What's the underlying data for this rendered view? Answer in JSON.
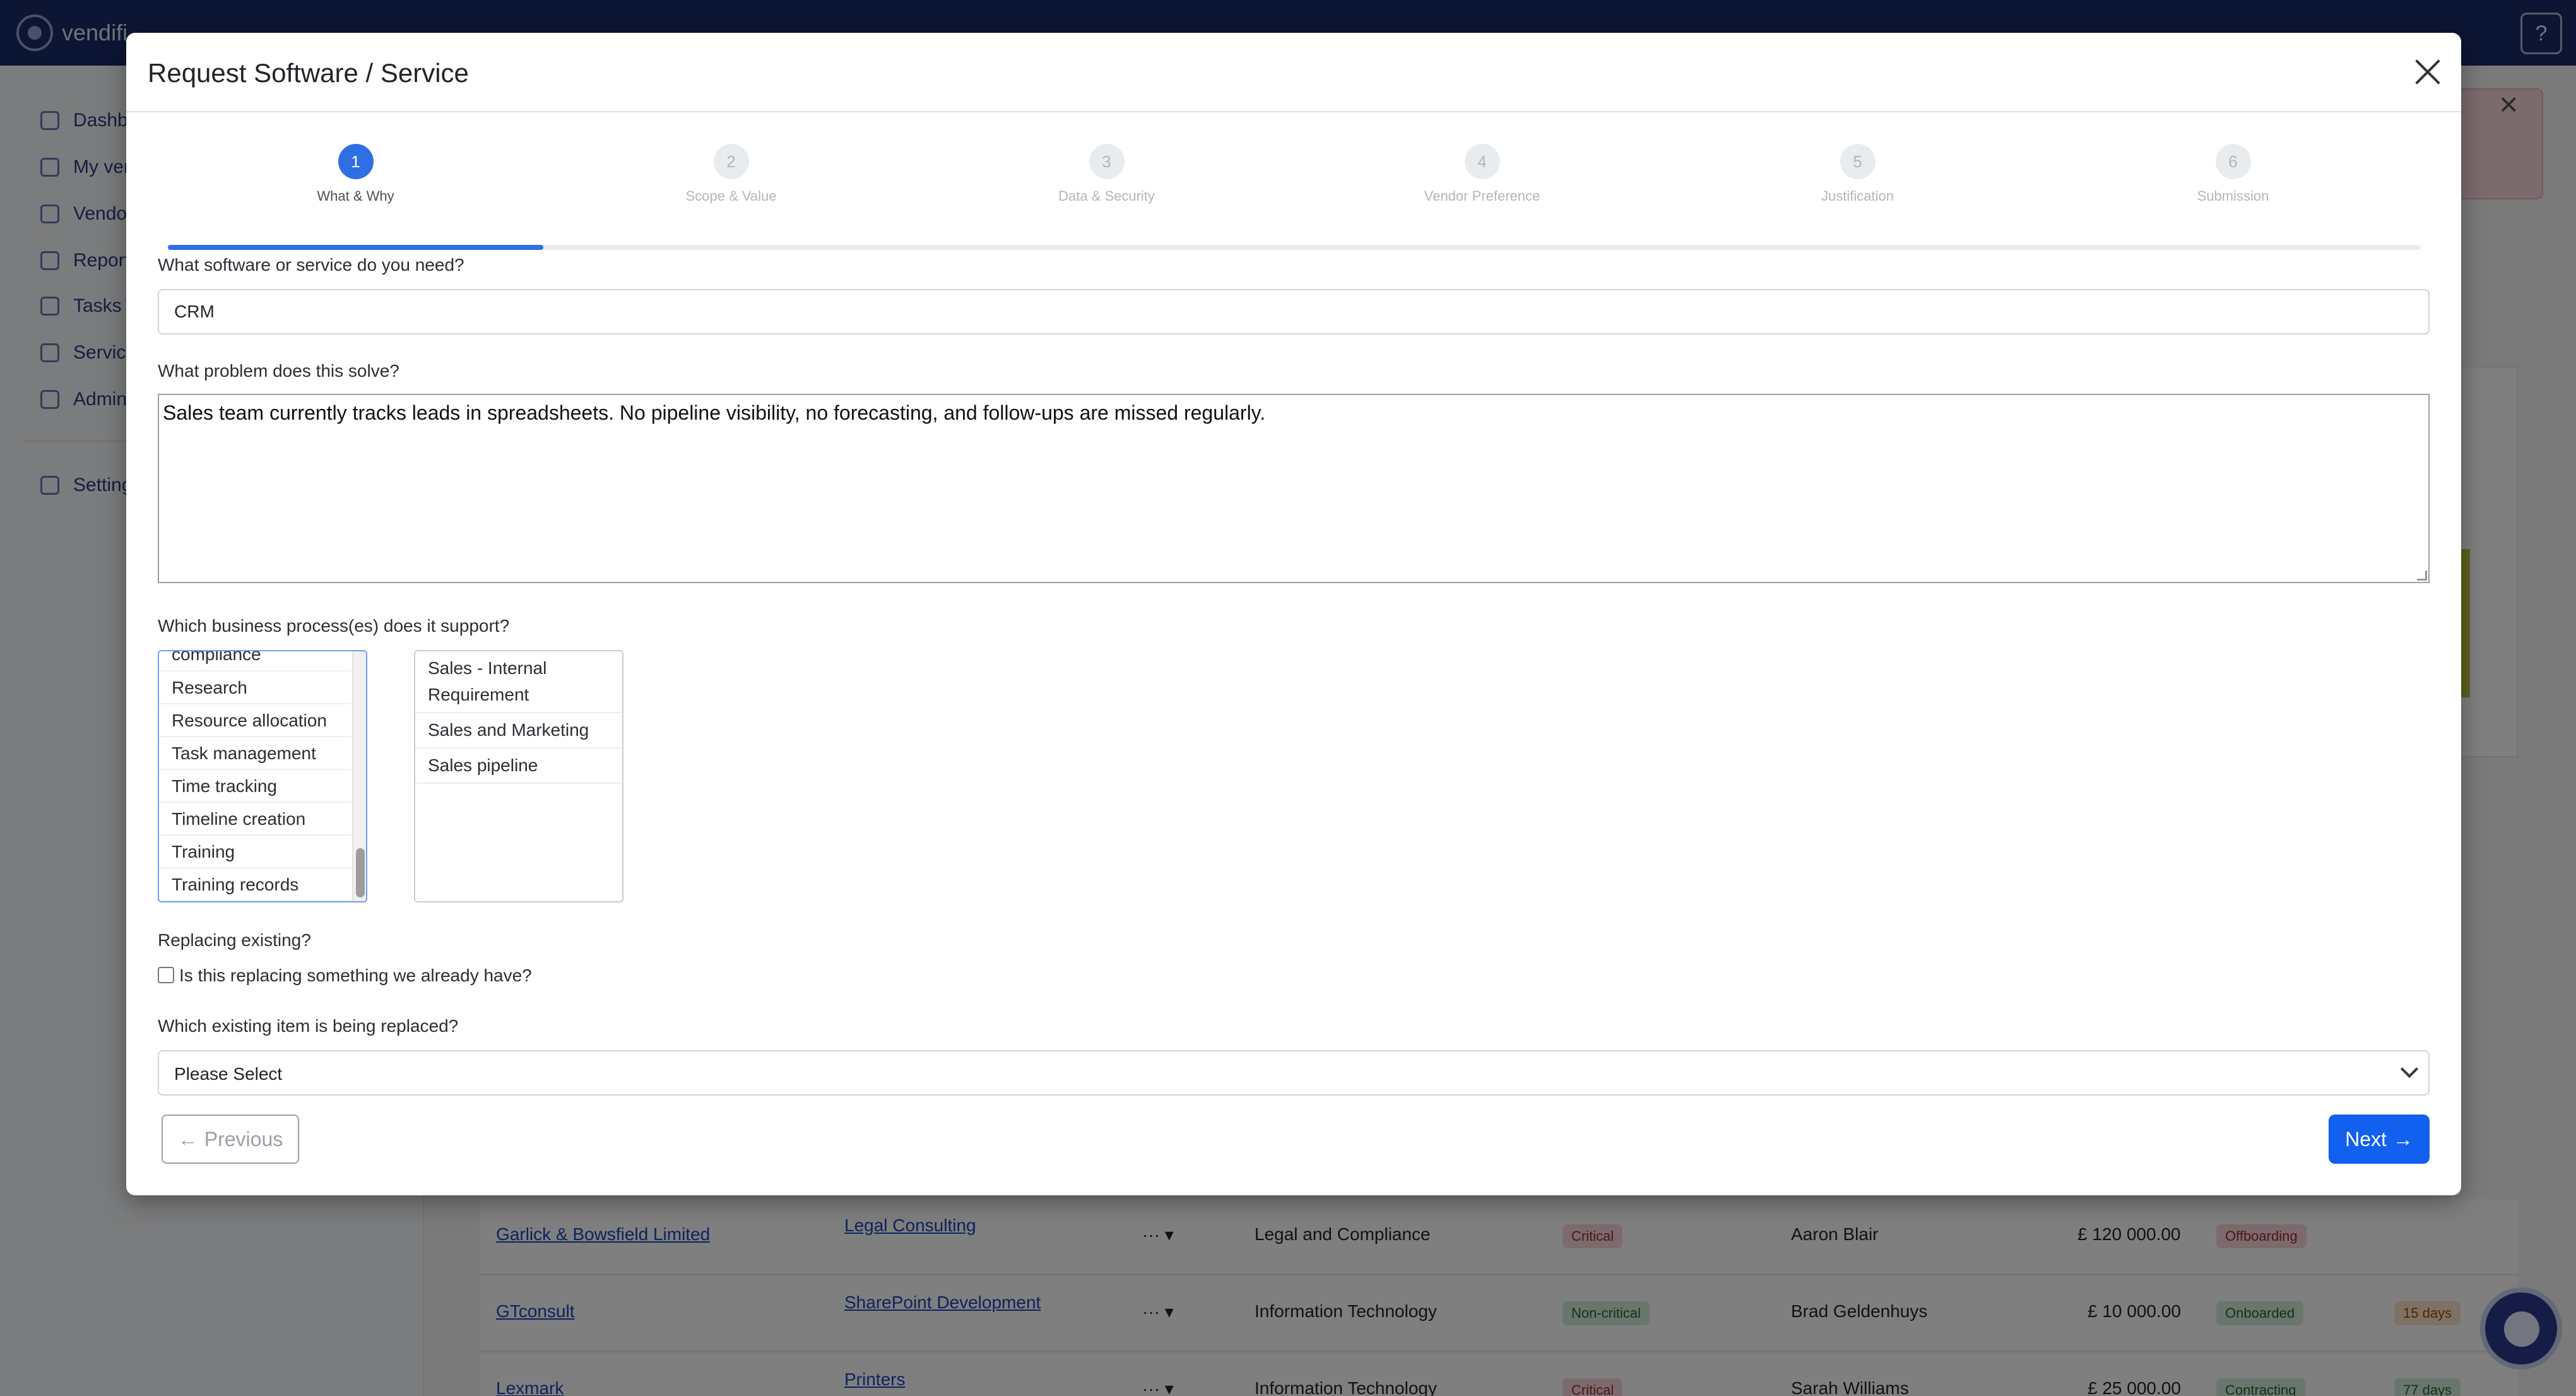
{
  "app": {
    "brand": "vendifi",
    "help_icon": "question-circle-icon"
  },
  "sidebar": {
    "items": [
      {
        "label": "Dashb",
        "icon": "dashboard-icon"
      },
      {
        "label": "My ver",
        "icon": "tag-icon"
      },
      {
        "label": "Vendo",
        "icon": "users-icon"
      },
      {
        "label": "Report",
        "icon": "calendar-icon"
      },
      {
        "label": "Tasks",
        "icon": "list-icon"
      },
      {
        "label": "Servic",
        "icon": "check-square-icon"
      },
      {
        "label": "Admin",
        "icon": "inbox-icon"
      },
      {
        "label": "Setting",
        "icon": "gear-icon"
      }
    ]
  },
  "background_table": {
    "rows": [
      {
        "vendor": "Garlick & Bowsfield Limited",
        "service": "Legal Consulting",
        "department": "Legal and Compliance",
        "criticality": "Critical",
        "owner": "Aaron Blair",
        "amount": "£ 120 000.00",
        "status": "Offboarding",
        "days": ""
      },
      {
        "vendor": "GTconsult",
        "service": "SharePoint Development",
        "department": "Information Technology",
        "criticality": "Non-critical",
        "owner": "Brad Geldenhuys",
        "amount": "£ 10 000.00",
        "status": "Onboarded",
        "days": "15 days"
      },
      {
        "vendor": "Lexmark",
        "service": "Printers",
        "department": "Information Technology",
        "criticality": "Critical",
        "owner": "Sarah Williams",
        "amount": "£ 25 000.00",
        "status": "Contracting",
        "days": "77 days"
      }
    ]
  },
  "modal": {
    "title": "Request Software / Service",
    "close_icon": "close-icon",
    "steps": [
      {
        "number": "1",
        "label": "What & Why",
        "active": true
      },
      {
        "number": "2",
        "label": "Scope & Value",
        "active": false
      },
      {
        "number": "3",
        "label": "Data & Security",
        "active": false
      },
      {
        "number": "4",
        "label": "Vendor Preference",
        "active": false
      },
      {
        "number": "5",
        "label": "Justification",
        "active": false
      },
      {
        "number": "6",
        "label": "Submission",
        "active": false
      }
    ],
    "progress_fraction": 0.1667,
    "software_question": "What software or service do you need?",
    "software_value": "CRM",
    "problem_question": "What problem does this solve?",
    "problem_value": "Sales team currently tracks leads in spreadsheets. No pipeline visibility, no forecasting, and follow-ups are missed regularly.",
    "process_question": "Which business process(es) does it support?",
    "process_available": [
      "compliance",
      "Research",
      "Resource allocation",
      "Task management",
      "Time tracking",
      "Timeline creation",
      "Training",
      "Training records"
    ],
    "process_selected": [
      "Sales - Internal Requirement",
      "Sales and Marketing",
      "Sales pipeline"
    ],
    "replacing_heading": "Replacing existing?",
    "replacing_checkbox_label": "Is this replacing something we already have?",
    "replacing_checked": false,
    "replaced_item_question": "Which existing item is being replaced?",
    "replaced_item_value": "Please Select",
    "previous_label": "Previous",
    "next_label": "Next",
    "previous_icon": "arrow-left-icon",
    "next_icon": "arrow-right-icon"
  }
}
